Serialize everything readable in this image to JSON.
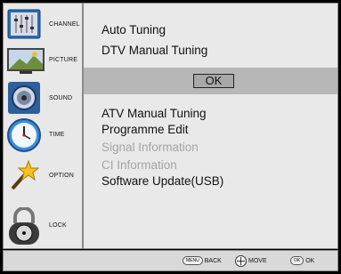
{
  "sidebar": {
    "items": [
      {
        "label": "CHANNEL"
      },
      {
        "label": "PICTURE"
      },
      {
        "label": "SOUND"
      },
      {
        "label": "TIME"
      },
      {
        "label": "OPTION"
      },
      {
        "label": "LOCK"
      }
    ]
  },
  "menu": {
    "items": [
      {
        "label": "Auto Tuning",
        "enabled": true
      },
      {
        "label": "DTV Manual Tuning",
        "enabled": true
      },
      {
        "label": "ATV Manual Tuning",
        "enabled": true
      },
      {
        "label": "Programme Edit",
        "enabled": true
      },
      {
        "label": "Signal Information",
        "enabled": false
      },
      {
        "label": "CI Information",
        "enabled": false
      },
      {
        "label": "Software Update(USB)",
        "enabled": true
      }
    ],
    "ok_label": "OK"
  },
  "footer": {
    "back": {
      "icon_text": "MENU",
      "label": "BACK"
    },
    "move": {
      "label": "MOVE"
    },
    "ok": {
      "icon_text": "OK",
      "label": "OK"
    }
  },
  "colors": {
    "panel": "#e9e9e9",
    "bar": "#b7b7b7",
    "disabled_text": "#a4a4a4"
  }
}
